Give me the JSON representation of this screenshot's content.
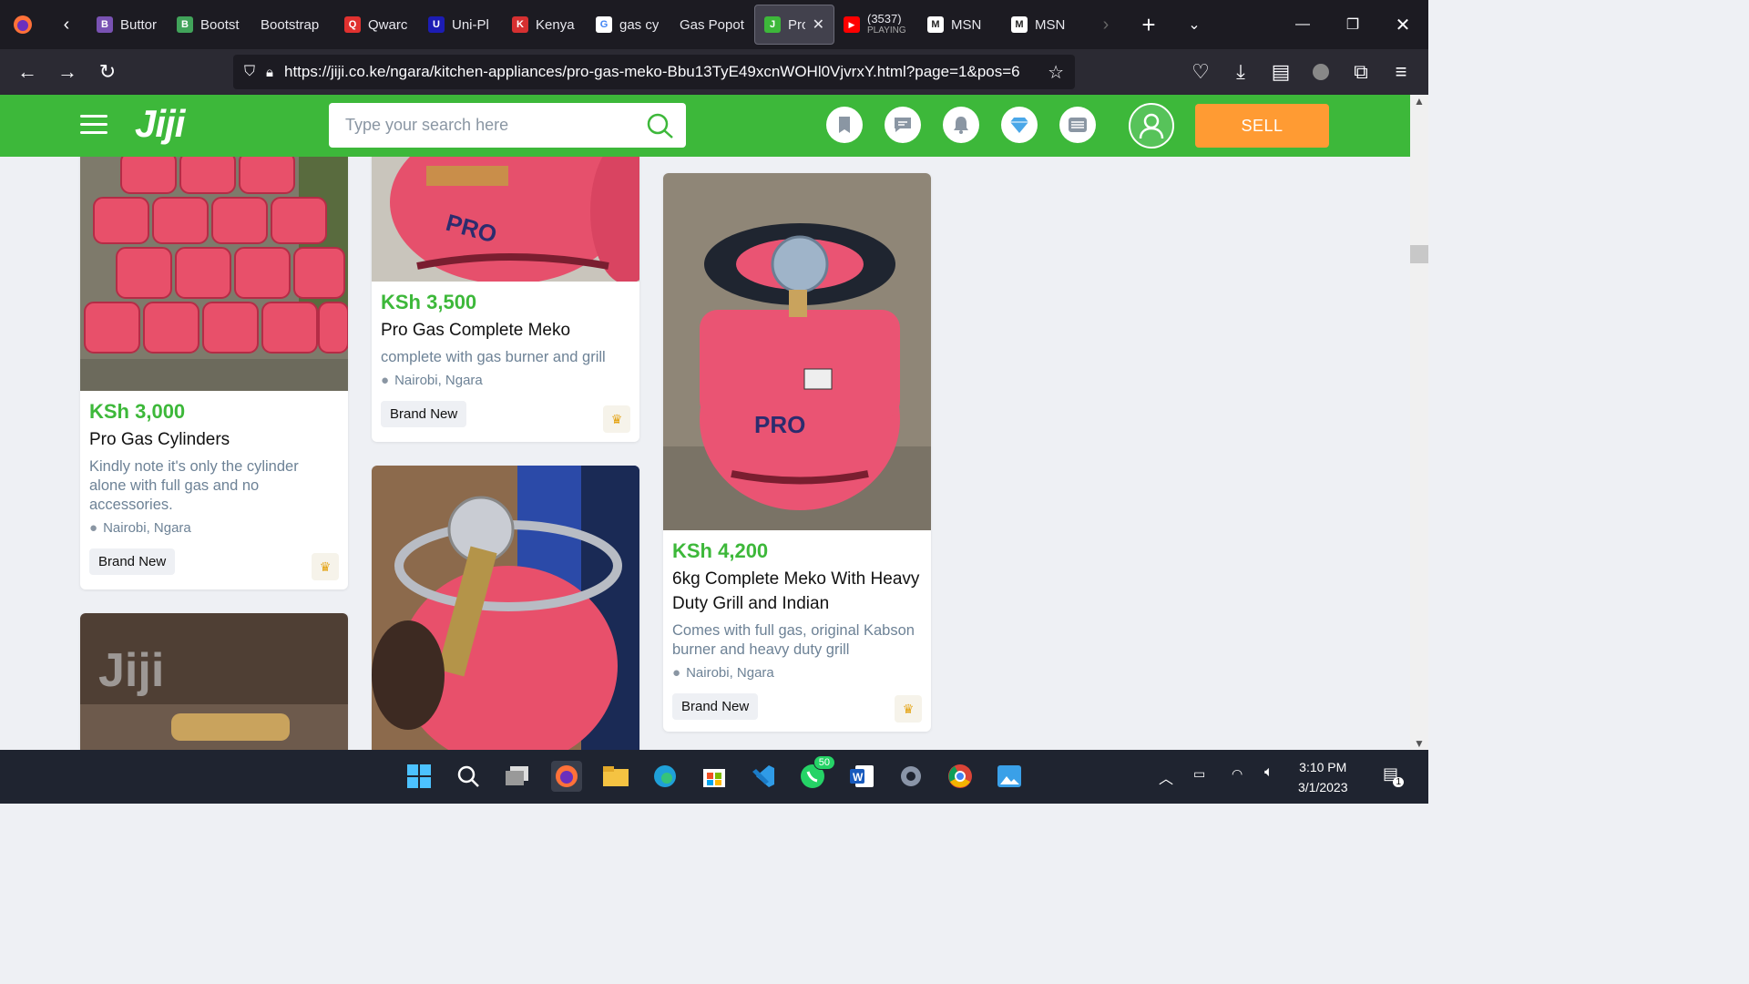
{
  "tabs": [
    {
      "label": "Buttor",
      "color": "#7952b3",
      "icon": "B"
    },
    {
      "label": "Bootst",
      "color": "#41a35a",
      "icon": "B"
    },
    {
      "label": "Bootstrap",
      "color": "",
      "icon": ""
    },
    {
      "label": "Qwarc",
      "color": "#e0312f",
      "icon": "Q"
    },
    {
      "label": "Uni-Pl",
      "color": "#1c1cb4",
      "icon": "U"
    },
    {
      "label": "Kenya",
      "color": "#d63031",
      "icon": "K"
    },
    {
      "label": "gas cy",
      "color": "#ffffff",
      "icon": "G"
    },
    {
      "label": "Gas Popot",
      "color": "",
      "icon": ""
    },
    {
      "label": "Pro",
      "color": "#3db83a",
      "icon": "J"
    },
    {
      "label": "(3537)",
      "sublabel": "PLAYING",
      "color": "#ff0000",
      "icon": "▶"
    },
    {
      "label": "MSN",
      "color": "#ffffff",
      "icon": "M"
    },
    {
      "label": "MSN",
      "color": "#ffffff",
      "icon": "M"
    }
  ],
  "address": {
    "url": "https://jiji.co.ke/ngara/kitchen-appliances/pro-gas-meko-Bbu13TyE49xcnWOHl0VjvrxY.html?page=1&pos=6"
  },
  "header": {
    "logo": "Jiji",
    "search_placeholder": "Type your search here",
    "sell_label": "SELL",
    "brand_color": "#3db83a",
    "sell_color": "#ff9b33"
  },
  "listings": [
    {
      "price": "KSh 3,000",
      "title": "Pro Gas Cylinders",
      "description": "Kindly note it's only the cylinder alone with full gas and no accessories.",
      "location": "Nairobi, Ngara",
      "condition": "Brand New"
    },
    {
      "price": "KSh 3,500",
      "title": "Pro Gas Complete Meko",
      "description": "complete with gas burner and grill",
      "location": "Nairobi, Ngara",
      "condition": "Brand New"
    },
    {
      "price": "KSh 4,200",
      "title": "6kg Complete Meko With Heavy Duty Grill and Indian",
      "description": "Comes with full gas, original Kabson burner and heavy duty grill",
      "location": "Nairobi, Ngara",
      "condition": "Brand New"
    }
  ],
  "image_watermark": "Jiji",
  "taskbar": {
    "whatsapp_badge": "50",
    "time": "3:10 PM",
    "date": "3/1/2023",
    "notif_count": "1"
  }
}
